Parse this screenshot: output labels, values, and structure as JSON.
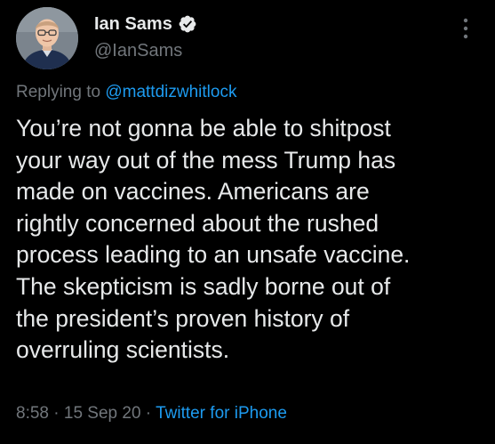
{
  "author": {
    "display_name": "Ian Sams",
    "handle": "@IanSams",
    "verified": true,
    "avatar_icon": "profile-photo-man-with-glasses"
  },
  "reply": {
    "prefix": "Replying to ",
    "target": "@mattdizwhitlock"
  },
  "tweet": {
    "lines": [
      "You’re not gonna be able to shitpost",
      "your way out of the mess Trump has",
      "made on vaccines. Americans are",
      "rightly concerned about the rushed",
      "process leading to an unsafe vaccine.",
      "The skepticism is sadly borne out of",
      "the president’s proven history of",
      "overruling scientists."
    ]
  },
  "meta": {
    "time": "8:58",
    "separator": " · ",
    "date": "15 Sep 20",
    "source": "Twitter for iPhone"
  },
  "icons": {
    "verified": "verified-badge-icon",
    "more": "more-options-icon"
  },
  "colors": {
    "background": "#000000",
    "text": "#e7e9ea",
    "secondary": "#71767b",
    "link": "#1d9bf0"
  }
}
